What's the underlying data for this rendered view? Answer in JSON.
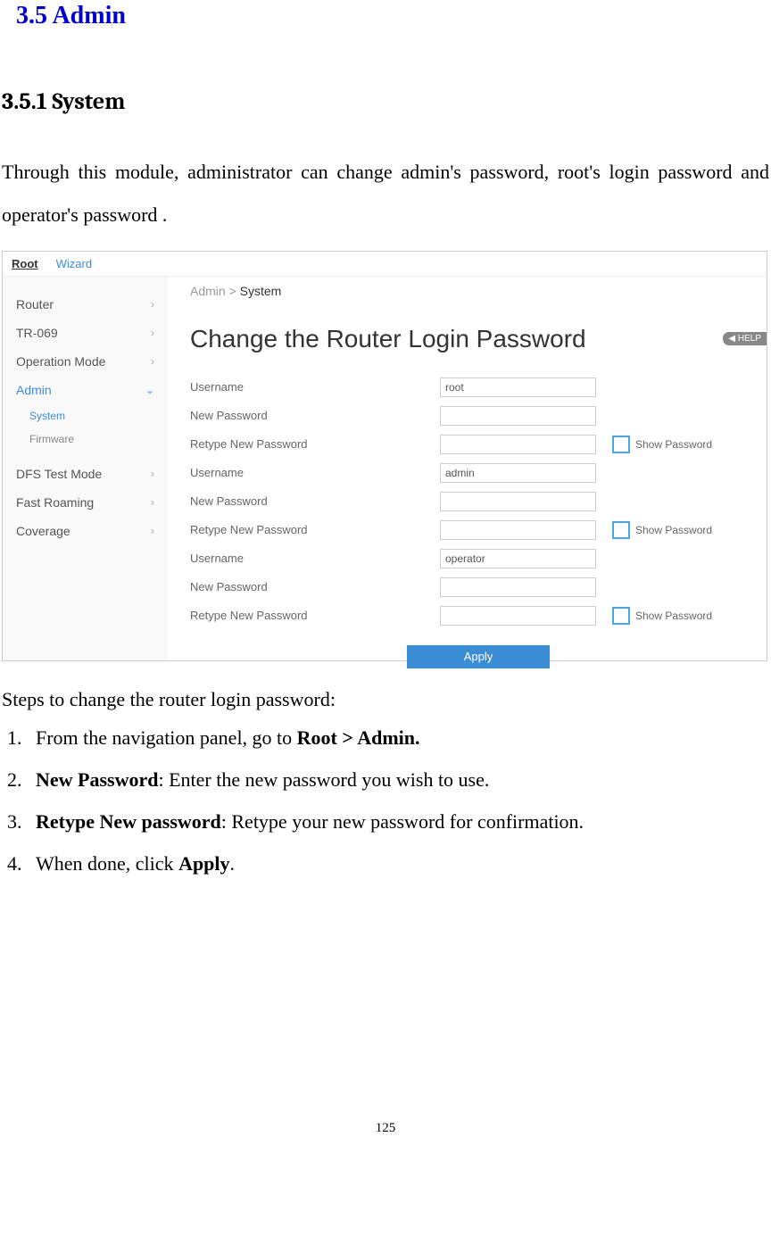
{
  "headings": {
    "section": "3.5 Admin",
    "subsection": "3.5.1 System"
  },
  "intro_paragraph": "Through this module, administrator can change admin's password, root's login password and operator's password .",
  "ui": {
    "top_tabs": {
      "root": "Root",
      "wizard": "Wizard"
    },
    "sidebar": {
      "router": "Router",
      "tr069": "TR-069",
      "op_mode": "Operation Mode",
      "admin": "Admin",
      "system": "System",
      "firmware": "Firmware",
      "dfs": "DFS Test Mode",
      "fast_roaming": "Fast Roaming",
      "coverage": "Coverage"
    },
    "breadcrumb_prefix": "Admin > ",
    "breadcrumb_current": "System",
    "panel_title": "Change the Router Login Password",
    "help_label": "HELP",
    "form": {
      "username_label": "Username",
      "new_password_label": "New Password",
      "retype_label": "Retype New Password",
      "show_password_label": "Show Password",
      "user1": "root",
      "user2": "admin",
      "user3": "operator"
    },
    "apply_button": "Apply"
  },
  "steps": {
    "intro": "Steps to change the router login password:",
    "step1_pre": "From the navigation panel, go to ",
    "step1_bold": "Root > Admin.",
    "step2_bold": "New Password",
    "step2_post": ": Enter the new password you wish to use.",
    "step3_bold": "Retype New password",
    "step3_post": ": Retype your new password for confirmation.",
    "step4_pre": "When done, click ",
    "step4_bold": "Apply",
    "step4_post": "."
  },
  "page_number": "125"
}
